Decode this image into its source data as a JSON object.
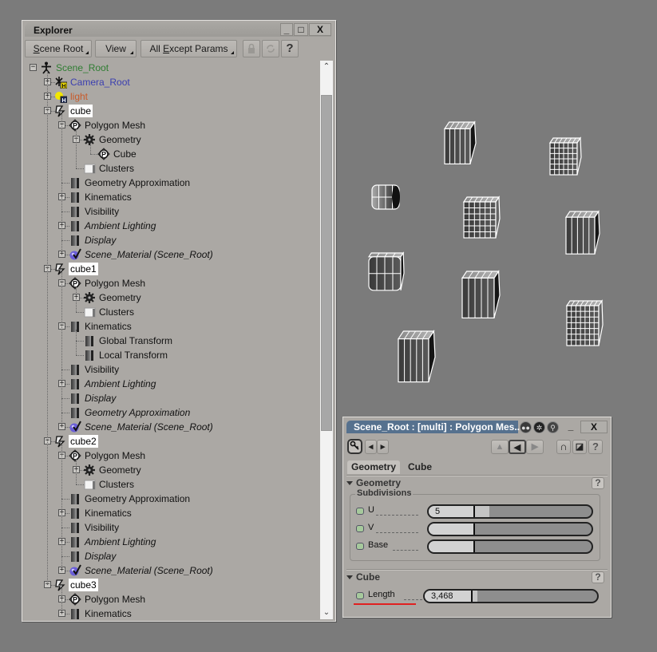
{
  "explorer": {
    "title": "Explorer",
    "window_buttons": {
      "minimize": "_",
      "maximize": "□",
      "close": "X"
    },
    "toolbar": {
      "scope_menu": {
        "prefix": "S",
        "rest": "cene Root"
      },
      "view_menu": "View",
      "filter_menu": {
        "pre": "All ",
        "accel": "E",
        "rest": "xcept Params"
      },
      "icons": [
        "lock-icon",
        "refresh-icon",
        "help-icon"
      ],
      "help_label": "?"
    },
    "tree": [
      {
        "label": "Scene_Root",
        "depth": 0,
        "expander": "-",
        "icon": "scene-root",
        "color": "#2f7d32"
      },
      {
        "label": "Camera_Root",
        "depth": 1,
        "expander": "+",
        "icon": "camera",
        "color": "#3b3fb0"
      },
      {
        "label": "light",
        "depth": 1,
        "expander": "+",
        "icon": "light",
        "color": "#c85a2a"
      },
      {
        "label": "cube",
        "depth": 1,
        "expander": "-",
        "icon": "model",
        "selected": true
      },
      {
        "label": "Polygon Mesh",
        "depth": 2,
        "expander": "-",
        "icon": "polymesh"
      },
      {
        "label": "Geometry",
        "depth": 3,
        "expander": "-",
        "icon": "gear"
      },
      {
        "label": "Cube",
        "depth": 4,
        "expander": "",
        "icon": "polymesh"
      },
      {
        "label": "Clusters",
        "depth": 3,
        "expander": "",
        "icon": "folder"
      },
      {
        "label": "Geometry Approximation",
        "depth": 2,
        "expander": "",
        "icon": "property"
      },
      {
        "label": "Kinematics",
        "depth": 2,
        "expander": "+",
        "icon": "property"
      },
      {
        "label": "Visibility",
        "depth": 2,
        "expander": "",
        "icon": "property"
      },
      {
        "label": "Ambient Lighting",
        "depth": 2,
        "expander": "+",
        "icon": "property",
        "italic": true
      },
      {
        "label": "Display",
        "depth": 2,
        "expander": "",
        "icon": "property",
        "italic": true
      },
      {
        "label": "Scene_Material (Scene_Root)",
        "depth": 2,
        "expander": "+",
        "icon": "material",
        "italic": true
      },
      {
        "label": "cube1",
        "depth": 1,
        "expander": "-",
        "icon": "model",
        "selected": true
      },
      {
        "label": "Polygon Mesh",
        "depth": 2,
        "expander": "-",
        "icon": "polymesh"
      },
      {
        "label": "Geometry",
        "depth": 3,
        "expander": "+",
        "icon": "gear"
      },
      {
        "label": "Clusters",
        "depth": 3,
        "expander": "",
        "icon": "folder"
      },
      {
        "label": "Kinematics",
        "depth": 2,
        "expander": "-",
        "icon": "property"
      },
      {
        "label": "Global Transform",
        "depth": 3,
        "expander": "",
        "icon": "property"
      },
      {
        "label": "Local Transform",
        "depth": 3,
        "expander": "",
        "icon": "property"
      },
      {
        "label": "Visibility",
        "depth": 2,
        "expander": "",
        "icon": "property"
      },
      {
        "label": "Ambient Lighting",
        "depth": 2,
        "expander": "+",
        "icon": "property",
        "italic": true
      },
      {
        "label": "Display",
        "depth": 2,
        "expander": "",
        "icon": "property",
        "italic": true
      },
      {
        "label": "Geometry Approximation",
        "depth": 2,
        "expander": "",
        "icon": "property",
        "italic": true
      },
      {
        "label": "Scene_Material (Scene_Root)",
        "depth": 2,
        "expander": "+",
        "icon": "material",
        "italic": true
      },
      {
        "label": "cube2",
        "depth": 1,
        "expander": "-",
        "icon": "model",
        "selected": true
      },
      {
        "label": "Polygon Mesh",
        "depth": 2,
        "expander": "-",
        "icon": "polymesh"
      },
      {
        "label": "Geometry",
        "depth": 3,
        "expander": "+",
        "icon": "gear"
      },
      {
        "label": "Clusters",
        "depth": 3,
        "expander": "",
        "icon": "folder"
      },
      {
        "label": "Geometry Approximation",
        "depth": 2,
        "expander": "",
        "icon": "property"
      },
      {
        "label": "Kinematics",
        "depth": 2,
        "expander": "+",
        "icon": "property"
      },
      {
        "label": "Visibility",
        "depth": 2,
        "expander": "",
        "icon": "property"
      },
      {
        "label": "Ambient Lighting",
        "depth": 2,
        "expander": "+",
        "icon": "property",
        "italic": true
      },
      {
        "label": "Display",
        "depth": 2,
        "expander": "",
        "icon": "property",
        "italic": true
      },
      {
        "label": "Scene_Material (Scene_Root)",
        "depth": 2,
        "expander": "+",
        "icon": "material",
        "italic": true
      },
      {
        "label": "cube3",
        "depth": 1,
        "expander": "-",
        "icon": "model",
        "selected": true
      },
      {
        "label": "Polygon Mesh",
        "depth": 2,
        "expander": "+",
        "icon": "polymesh"
      },
      {
        "label": "Kinematics",
        "depth": 2,
        "expander": "+",
        "icon": "property"
      }
    ],
    "scrollbar": {
      "up": "⌃",
      "down": "⌄",
      "thumb_start_fraction": 0.04,
      "thumb_visible_fraction": 0.63
    }
  },
  "viewport": {
    "background": "#7b7b7b",
    "objects": [
      {
        "name": "cube-top-center",
        "shape": "box",
        "divisions": [
          5,
          1
        ]
      },
      {
        "name": "cube-top-right",
        "shape": "box",
        "divisions": [
          6,
          6
        ]
      },
      {
        "name": "cylinder-left",
        "shape": "cylinder",
        "divisions": [
          4,
          1
        ]
      },
      {
        "name": "cube-center",
        "shape": "box",
        "divisions": [
          6,
          6
        ]
      },
      {
        "name": "cube-right",
        "shape": "box",
        "divisions": [
          5,
          1
        ]
      },
      {
        "name": "rounded-cube-left",
        "shape": "rounded",
        "divisions": [
          4,
          2
        ]
      },
      {
        "name": "cube-middle",
        "shape": "box",
        "divisions": [
          5,
          1
        ]
      },
      {
        "name": "cube-bottom-right",
        "shape": "box",
        "divisions": [
          7,
          7
        ]
      },
      {
        "name": "cube-bottom-left",
        "shape": "box",
        "divisions": [
          5,
          1
        ]
      }
    ]
  },
  "ppg": {
    "title": "Scene_Root : [multi] : Polygon Mes...",
    "title_bar_color": "#56718e",
    "header_icons": [
      "inspect-icon",
      "recycle-icon",
      "lock-keyhole-icon"
    ],
    "window_buttons": {
      "minimize": "_",
      "close": "X"
    },
    "toolbar": {
      "help_label": "?"
    },
    "tabs": [
      {
        "label": "Geometry",
        "active": true
      },
      {
        "label": "Cube",
        "active": false
      }
    ],
    "sections": {
      "geometry": {
        "title": "Geometry",
        "help": "?",
        "group": "Subdivisions",
        "params": [
          {
            "label": "U",
            "value": "5",
            "fill_fraction": 0.13
          },
          {
            "label": "V",
            "value": "",
            "fill_fraction": 0
          },
          {
            "label": "Base",
            "value": "",
            "fill_fraction": 0
          }
        ]
      },
      "cube": {
        "title": "Cube",
        "help": "?",
        "params": [
          {
            "label": "Length",
            "value": "3,468",
            "fill_fraction": 0.05
          }
        ]
      }
    },
    "highlight_color": "#e02020"
  }
}
